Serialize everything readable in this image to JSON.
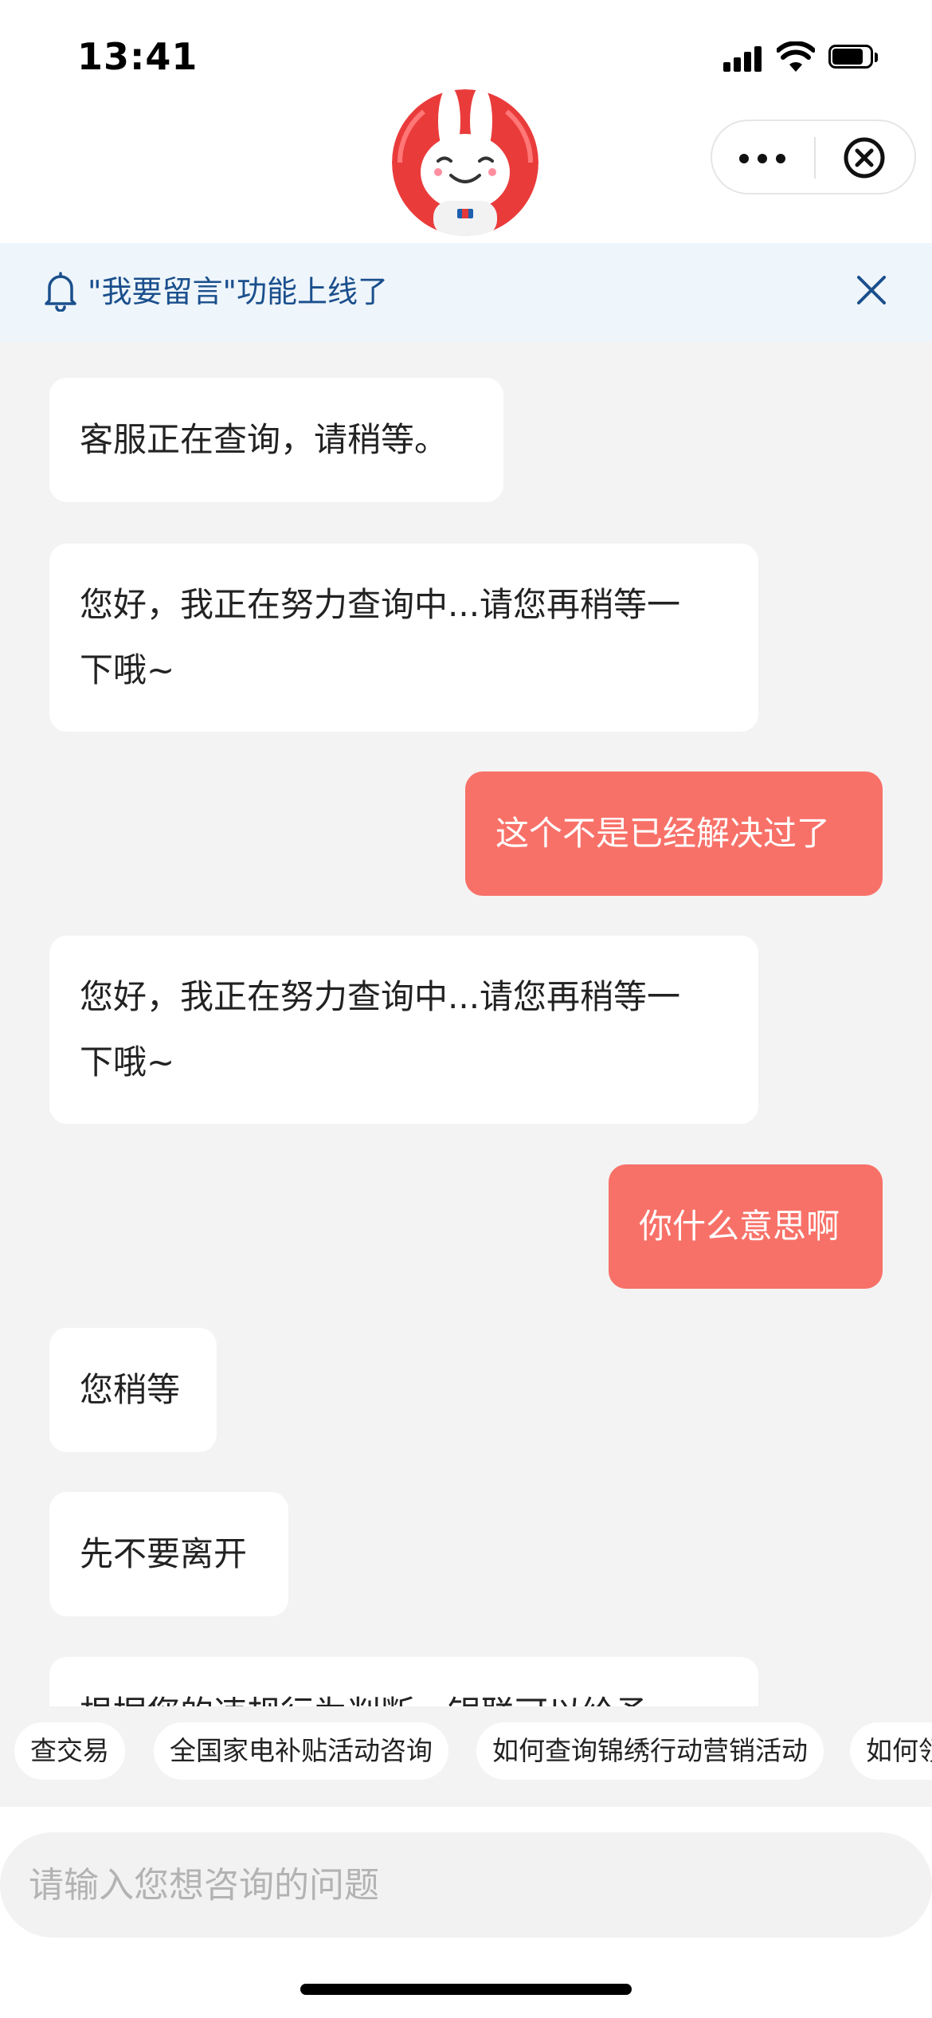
{
  "status_bar": {
    "time": "13:41"
  },
  "notice": {
    "text": "\"我要留言\"功能上线了"
  },
  "messages": [
    {
      "side": "agent",
      "text": "客服正在查询，请稍等。"
    },
    {
      "side": "agent",
      "lines": [
        "您好，我正在努力查询中...请您再稍等一",
        "下哦~"
      ]
    },
    {
      "side": "me",
      "text": "这个不是已经解决过了"
    },
    {
      "side": "agent",
      "lines": [
        "您好，我正在努力查询中...请您再稍等一",
        "下哦~"
      ]
    },
    {
      "side": "me",
      "text": "你什么意思啊"
    },
    {
      "side": "agent",
      "text": "您稍等"
    },
    {
      "side": "agent",
      "text": "先不要离开"
    },
    {
      "side": "agent",
      "text": "根据您的违规行为判断，银联可以给予"
    }
  ],
  "quick_replies": [
    "查交易",
    "全国家电补贴活动咨询",
    "如何查询锦绣行动营销活动",
    "如何领"
  ],
  "input": {
    "placeholder": "请输入您想咨询的问题"
  },
  "colors": {
    "agent_bubble": "#ffffff",
    "user_bubble": "#f87168",
    "notice_bg": "#eef5fb",
    "notice_text": "#1a4f8c",
    "background": "#f3f3f3"
  }
}
